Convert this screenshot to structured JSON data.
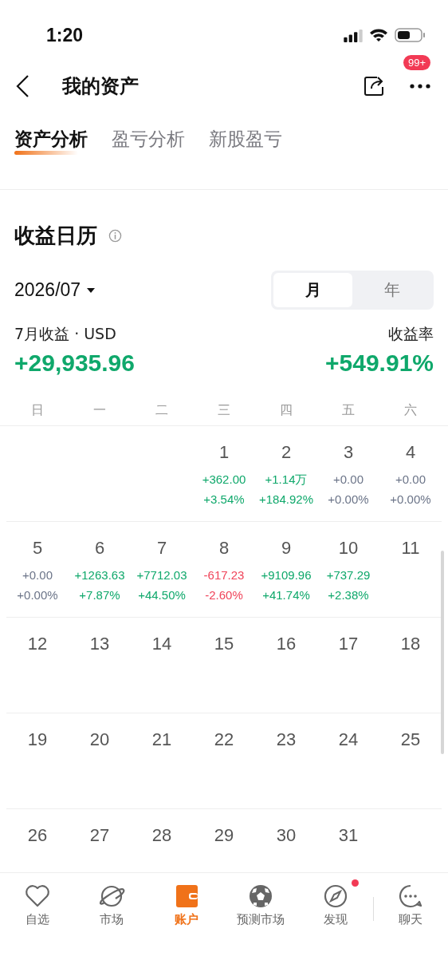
{
  "status_bar": {
    "time": "1:20"
  },
  "header": {
    "title": "我的资产",
    "badge": "99+"
  },
  "tabs": [
    {
      "label": "资产分析",
      "selected": true
    },
    {
      "label": "盈亏分析",
      "selected": false
    },
    {
      "label": "新股盈亏",
      "selected": false
    }
  ],
  "section": {
    "title": "收益日历"
  },
  "period": {
    "value": "2026/07",
    "options": [
      {
        "label": "月",
        "selected": true
      },
      {
        "label": "年",
        "selected": false
      }
    ]
  },
  "summary": {
    "label": "7月收益 · USD",
    "amount": "+29,935.96",
    "rate_label": "收益率",
    "rate": "+549.91%",
    "color": "#0fa86b"
  },
  "weekdays": [
    "日",
    "一",
    "二",
    "三",
    "四",
    "五",
    "六"
  ],
  "weeks": [
    [
      {
        "kind": "blank"
      },
      {
        "kind": "blank"
      },
      {
        "kind": "blank"
      },
      {
        "kind": "day",
        "day": "1",
        "pnl": "+362.00",
        "pct": "+3.54%",
        "color": "#0fa86b"
      },
      {
        "kind": "day",
        "day": "2",
        "pnl": "+1.14万",
        "pct": "+184.92%",
        "color": "#0fa86b"
      },
      {
        "kind": "day",
        "day": "3",
        "pnl": "+0.00",
        "pct": "+0.00%",
        "color": "#6b7488"
      },
      {
        "kind": "day",
        "day": "4",
        "pnl": "+0.00",
        "pct": "+0.00%",
        "color": "#6b7488"
      }
    ],
    [
      {
        "kind": "day",
        "day": "5",
        "pnl": "+0.00",
        "pct": "+0.00%",
        "color": "#6b7488"
      },
      {
        "kind": "day",
        "day": "6",
        "pnl": "+1263.63",
        "pct": "+7.87%",
        "color": "#0fa86b"
      },
      {
        "kind": "day",
        "day": "7",
        "pnl": "+7712.03",
        "pct": "+44.50%",
        "color": "#0fa86b"
      },
      {
        "kind": "day",
        "day": "8",
        "pnl": "-617.23",
        "pct": "-2.60%",
        "color": "#f0445a"
      },
      {
        "kind": "day",
        "day": "9",
        "pnl": "+9109.96",
        "pct": "+41.74%",
        "color": "#0fa86b"
      },
      {
        "kind": "day",
        "day": "10",
        "pnl": "+737.29",
        "pct": "+2.38%",
        "color": "#0fa86b"
      },
      {
        "kind": "day",
        "day": "11"
      }
    ],
    [
      {
        "kind": "day",
        "day": "12"
      },
      {
        "kind": "day",
        "day": "13"
      },
      {
        "kind": "day",
        "day": "14"
      },
      {
        "kind": "day",
        "day": "15"
      },
      {
        "kind": "day",
        "day": "16"
      },
      {
        "kind": "day",
        "day": "17"
      },
      {
        "kind": "day",
        "day": "18"
      }
    ],
    [
      {
        "kind": "day",
        "day": "19"
      },
      {
        "kind": "day",
        "day": "20"
      },
      {
        "kind": "day",
        "day": "21"
      },
      {
        "kind": "day",
        "day": "22"
      },
      {
        "kind": "day",
        "day": "23"
      },
      {
        "kind": "day",
        "day": "24"
      },
      {
        "kind": "day",
        "day": "25"
      }
    ],
    [
      {
        "kind": "day",
        "day": "26"
      },
      {
        "kind": "day",
        "day": "27"
      },
      {
        "kind": "day",
        "day": "28"
      },
      {
        "kind": "day",
        "day": "29"
      },
      {
        "kind": "day",
        "day": "30"
      },
      {
        "kind": "day",
        "day": "31"
      },
      {
        "kind": "blank"
      }
    ]
  ],
  "bottom_nav": [
    {
      "label": "自选",
      "kind": "heart",
      "selected": false,
      "dot": false
    },
    {
      "label": "市场",
      "kind": "planet",
      "selected": false,
      "dot": false
    },
    {
      "label": "账户",
      "kind": "wallet",
      "selected": true,
      "dot": false
    },
    {
      "label": "预测市场",
      "kind": "ball",
      "selected": false,
      "dot": false
    },
    {
      "label": "发现",
      "kind": "compass",
      "selected": false,
      "dot": true
    },
    {
      "label": "聊天",
      "kind": "chat",
      "selected": false,
      "dot": false
    }
  ]
}
